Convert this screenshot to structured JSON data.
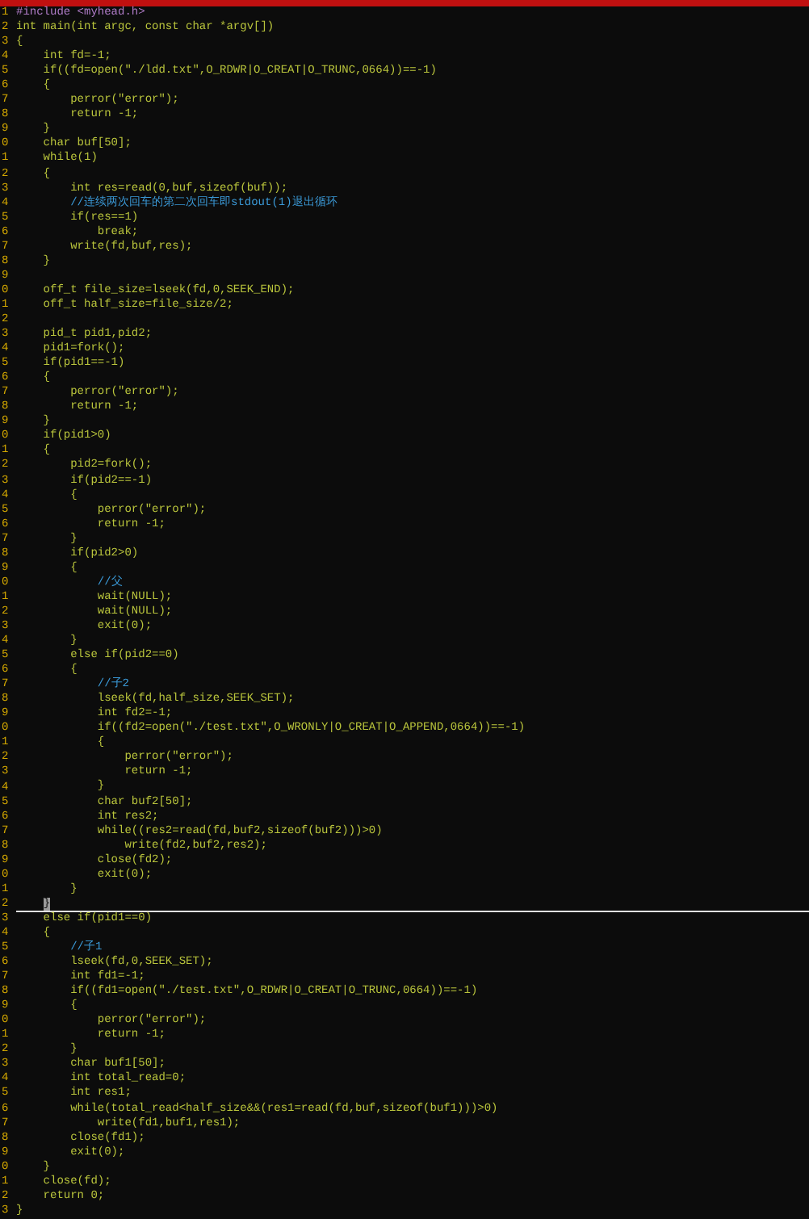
{
  "editor": {
    "lines": [
      {
        "number": "1",
        "text": "#include <myhead.h>",
        "kind": "preproc",
        "current": false
      },
      {
        "number": "2",
        "text": "int main(int argc, const char *argv[])",
        "kind": "code",
        "current": false
      },
      {
        "number": "3",
        "text": "{",
        "kind": "code",
        "current": false
      },
      {
        "number": "4",
        "text": "    int fd=-1;",
        "kind": "code",
        "current": false
      },
      {
        "number": "5",
        "text": "    if((fd=open(\"./ldd.txt\",O_RDWR|O_CREAT|O_TRUNC,0664))==-1)",
        "kind": "code",
        "current": false
      },
      {
        "number": "6",
        "text": "    {",
        "kind": "code",
        "current": false
      },
      {
        "number": "7",
        "text": "        perror(\"error\");",
        "kind": "code",
        "current": false
      },
      {
        "number": "8",
        "text": "        return -1;",
        "kind": "code",
        "current": false
      },
      {
        "number": "9",
        "text": "    }",
        "kind": "code",
        "current": false
      },
      {
        "number": "0",
        "text": "    char buf[50];",
        "kind": "code",
        "current": false
      },
      {
        "number": "1",
        "text": "    while(1)",
        "kind": "code",
        "current": false
      },
      {
        "number": "2",
        "text": "    {",
        "kind": "code",
        "current": false
      },
      {
        "number": "3",
        "text": "        int res=read(0,buf,sizeof(buf));",
        "kind": "code",
        "current": false
      },
      {
        "number": "4",
        "text": "        //连续两次回车的第二次回车即stdout(1)退出循环",
        "kind": "comment",
        "current": false
      },
      {
        "number": "5",
        "text": "        if(res==1)",
        "kind": "code",
        "current": false
      },
      {
        "number": "6",
        "text": "            break;",
        "kind": "code",
        "current": false
      },
      {
        "number": "7",
        "text": "        write(fd,buf,res);",
        "kind": "code",
        "current": false
      },
      {
        "number": "8",
        "text": "    }",
        "kind": "code",
        "current": false
      },
      {
        "number": "9",
        "kind": "code",
        "current": false
      },
      {
        "number": "0",
        "text": "    off_t file_size=lseek(fd,0,SEEK_END);",
        "kind": "code",
        "current": false
      },
      {
        "number": "1",
        "text": "    off_t half_size=file_size/2;",
        "kind": "code",
        "current": false
      },
      {
        "number": "2",
        "kind": "code",
        "current": false
      },
      {
        "number": "3",
        "text": "    pid_t pid1,pid2;",
        "kind": "code",
        "current": false
      },
      {
        "number": "4",
        "text": "    pid1=fork();",
        "kind": "code",
        "current": false
      },
      {
        "number": "5",
        "text": "    if(pid1==-1)",
        "kind": "code",
        "current": false
      },
      {
        "number": "6",
        "text": "    {",
        "kind": "code",
        "current": false
      },
      {
        "number": "7",
        "text": "        perror(\"error\");",
        "kind": "code",
        "current": false
      },
      {
        "number": "8",
        "text": "        return -1;",
        "kind": "code",
        "current": false
      },
      {
        "number": "9",
        "text": "    }",
        "kind": "code",
        "current": false
      },
      {
        "number": "0",
        "text": "    if(pid1>0)",
        "kind": "code",
        "current": false
      },
      {
        "number": "1",
        "text": "    {",
        "kind": "code",
        "current": false
      },
      {
        "number": "2",
        "text": "        pid2=fork();",
        "kind": "code",
        "current": false
      },
      {
        "number": "3",
        "text": "        if(pid2==-1)",
        "kind": "code",
        "current": false
      },
      {
        "number": "4",
        "text": "        {",
        "kind": "code",
        "current": false
      },
      {
        "number": "5",
        "text": "            perror(\"error\");",
        "kind": "code",
        "current": false
      },
      {
        "number": "6",
        "text": "            return -1;",
        "kind": "code",
        "current": false
      },
      {
        "number": "7",
        "text": "        }",
        "kind": "code",
        "current": false
      },
      {
        "number": "8",
        "text": "        if(pid2>0)",
        "kind": "code",
        "current": false
      },
      {
        "number": "9",
        "text": "        {",
        "kind": "code",
        "current": false
      },
      {
        "number": "0",
        "text": "            //父",
        "kind": "comment",
        "current": false
      },
      {
        "number": "1",
        "text": "            wait(NULL);",
        "kind": "code",
        "current": false
      },
      {
        "number": "2",
        "text": "            wait(NULL);",
        "kind": "code",
        "current": false
      },
      {
        "number": "3",
        "text": "            exit(0);",
        "kind": "code",
        "current": false
      },
      {
        "number": "4",
        "text": "        }",
        "kind": "code",
        "current": false
      },
      {
        "number": "5",
        "text": "        else if(pid2==0)",
        "kind": "code",
        "current": false
      },
      {
        "number": "6",
        "text": "        {",
        "kind": "code",
        "current": false
      },
      {
        "number": "7",
        "text": "            //子2",
        "kind": "comment",
        "current": false
      },
      {
        "number": "8",
        "text": "            lseek(fd,half_size,SEEK_SET);",
        "kind": "code",
        "current": false
      },
      {
        "number": "9",
        "text": "            int fd2=-1;",
        "kind": "code",
        "current": false
      },
      {
        "number": "0",
        "text": "            if((fd2=open(\"./test.txt\",O_WRONLY|O_CREAT|O_APPEND,0664))==-1)",
        "kind": "code",
        "current": false
      },
      {
        "number": "1",
        "text": "            {",
        "kind": "code",
        "current": false
      },
      {
        "number": "2",
        "text": "                perror(\"error\");",
        "kind": "code",
        "current": false
      },
      {
        "number": "3",
        "text": "                return -1;",
        "kind": "code",
        "current": false
      },
      {
        "number": "4",
        "text": "            }",
        "kind": "code",
        "current": false
      },
      {
        "number": "5",
        "text": "            char buf2[50];",
        "kind": "code",
        "current": false
      },
      {
        "number": "6",
        "text": "            int res2;",
        "kind": "code",
        "current": false
      },
      {
        "number": "7",
        "text": "            while((res2=read(fd,buf2,sizeof(buf2)))>0)",
        "kind": "code",
        "current": false
      },
      {
        "number": "8",
        "text": "                write(fd2,buf2,res2);",
        "kind": "code",
        "current": false
      },
      {
        "number": "9",
        "text": "            close(fd2);",
        "kind": "code",
        "current": false
      },
      {
        "number": "0",
        "text": "            exit(0);",
        "kind": "code",
        "current": false
      },
      {
        "number": "1",
        "text": "        }",
        "kind": "code",
        "current": false
      },
      {
        "number": "2",
        "text": "    }",
        "kind": "code",
        "current": true
      },
      {
        "number": "3",
        "text": "    else if(pid1==0)",
        "kind": "code",
        "current": false
      },
      {
        "number": "4",
        "text": "    {",
        "kind": "code",
        "current": false
      },
      {
        "number": "5",
        "text": "        //子1",
        "kind": "comment",
        "current": false
      },
      {
        "number": "6",
        "text": "        lseek(fd,0,SEEK_SET);",
        "kind": "code",
        "current": false
      },
      {
        "number": "7",
        "text": "        int fd1=-1;",
        "kind": "code",
        "current": false
      },
      {
        "number": "8",
        "text": "        if((fd1=open(\"./test.txt\",O_RDWR|O_CREAT|O_TRUNC,0664))==-1)",
        "kind": "code",
        "current": false
      },
      {
        "number": "9",
        "text": "        {",
        "kind": "code",
        "current": false
      },
      {
        "number": "0",
        "text": "            perror(\"error\");",
        "kind": "code",
        "current": false
      },
      {
        "number": "1",
        "text": "            return -1;",
        "kind": "code",
        "current": false
      },
      {
        "number": "2",
        "text": "        }",
        "kind": "code",
        "current": false
      },
      {
        "number": "3",
        "text": "        char buf1[50];",
        "kind": "code",
        "current": false
      },
      {
        "number": "4",
        "text": "        int total_read=0;",
        "kind": "code",
        "current": false
      },
      {
        "number": "5",
        "text": "        int res1;",
        "kind": "code",
        "current": false
      },
      {
        "number": "6",
        "text": "        while(total_read<half_size&&(res1=read(fd,buf,sizeof(buf1)))>0)",
        "kind": "code",
        "current": false
      },
      {
        "number": "7",
        "text": "            write(fd1,buf1,res1);",
        "kind": "code",
        "current": false
      },
      {
        "number": "8",
        "text": "        close(fd1);",
        "kind": "code",
        "current": false
      },
      {
        "number": "9",
        "text": "        exit(0);",
        "kind": "code",
        "current": false
      },
      {
        "number": "0",
        "text": "    }",
        "kind": "code",
        "current": false
      },
      {
        "number": "1",
        "text": "    close(fd);",
        "kind": "code",
        "current": false
      },
      {
        "number": "2",
        "text": "    return 0;",
        "kind": "code",
        "current": false
      },
      {
        "number": "3",
        "text": "}",
        "kind": "code",
        "current": false
      }
    ]
  }
}
